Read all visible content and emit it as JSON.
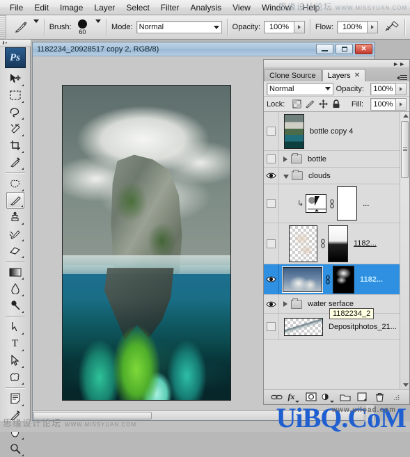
{
  "app": {
    "name": "Adobe Photoshop",
    "logo_text": "Ps"
  },
  "menubar": {
    "items": [
      {
        "label": "File"
      },
      {
        "label": "Edit"
      },
      {
        "label": "Image"
      },
      {
        "label": "Layer"
      },
      {
        "label": "Select"
      },
      {
        "label": "Filter"
      },
      {
        "label": "Analysis"
      },
      {
        "label": "View"
      },
      {
        "label": "Window"
      },
      {
        "label": "Help"
      }
    ]
  },
  "options_bar": {
    "tool_icon": "brush-icon",
    "brush_label": "Brush:",
    "brush_size": "60",
    "mode_label": "Mode:",
    "mode_value": "Normal",
    "opacity_label": "Opacity:",
    "opacity_value": "100%",
    "flow_label": "Flow:",
    "flow_value": "100%",
    "airbrush_icon": "airbrush-icon"
  },
  "toolbox": {
    "tools": [
      {
        "name": "move-tool"
      },
      {
        "name": "rectangular-marquee-tool"
      },
      {
        "name": "lasso-tool"
      },
      {
        "name": "magic-wand-tool"
      },
      {
        "name": "crop-tool"
      },
      {
        "name": "eyedropper-tool"
      },
      {
        "name": "patch-healing-tool"
      },
      {
        "name": "brush-tool"
      },
      {
        "name": "clone-stamp-tool"
      },
      {
        "name": "history-brush-tool"
      },
      {
        "name": "eraser-tool"
      },
      {
        "name": "gradient-tool"
      },
      {
        "name": "blur-tool"
      },
      {
        "name": "dodge-tool"
      },
      {
        "name": "pen-tool"
      },
      {
        "name": "type-tool"
      },
      {
        "name": "path-selection-tool"
      },
      {
        "name": "custom-shape-tool"
      },
      {
        "name": "notes-tool"
      },
      {
        "name": "eyedropper-sample-tool"
      },
      {
        "name": "hand-tool"
      },
      {
        "name": "zoom-tool"
      }
    ],
    "active_tool": "brush-tool"
  },
  "document_window": {
    "title": "1182234_20928517 copy 2, RGB/8)",
    "buttons": {
      "minimize": "minimize-button",
      "maximize": "maximize-button",
      "close": "✕"
    }
  },
  "layers_panel": {
    "tabs": [
      {
        "label": "Clone Source",
        "active": false,
        "closable": false
      },
      {
        "label": "Layers",
        "active": true,
        "closable": true,
        "close_glyph": "✕"
      }
    ],
    "blend_mode": "Normal",
    "opacity_label": "Opacity:",
    "opacity_value": "100%",
    "lock_label": "Lock:",
    "lock_icons": [
      "lock-transparent-pixels-icon",
      "lock-image-pixels-icon",
      "lock-position-icon",
      "lock-all-icon"
    ],
    "fill_label": "Fill:",
    "fill_value": "100%",
    "rows": [
      {
        "name": "bottle copy 4",
        "visible": false,
        "type": "layer",
        "thumb": "island-thumb"
      },
      {
        "name": "bottle",
        "visible": false,
        "type": "group",
        "expanded": false
      },
      {
        "name": "clouds",
        "visible": true,
        "type": "group",
        "expanded": true
      },
      {
        "name": "...",
        "visible": false,
        "type": "adjustment",
        "thumb": "gradient-map-thumb",
        "mask": "white-mask"
      },
      {
        "name": "1182...",
        "visible": false,
        "type": "layer",
        "thumb": "clouds-transparent-thumb",
        "mask": "gradient-mask"
      },
      {
        "name": "1182...",
        "visible": true,
        "type": "layer",
        "selected": true,
        "thumb": "clouds-photo-thumb",
        "mask": "black-mask"
      },
      {
        "name": "water serface",
        "visible": true,
        "type": "group",
        "expanded": false
      },
      {
        "name": "Depositphotos_21...",
        "visible": false,
        "type": "layer",
        "thumb": "water-surface-thumb"
      }
    ],
    "bottom_buttons": [
      {
        "name": "link-layers-button",
        "glyph": "link-icon"
      },
      {
        "name": "layer-style-button",
        "glyph": "fx-icon"
      },
      {
        "name": "add-layer-mask-button",
        "glyph": "mask-icon"
      },
      {
        "name": "new-adjustment-layer-button",
        "glyph": "half-circle-icon"
      },
      {
        "name": "new-group-button",
        "glyph": "folder-icon"
      },
      {
        "name": "new-layer-button",
        "glyph": "new-layer-icon"
      },
      {
        "name": "delete-layer-button",
        "glyph": "trash-icon"
      }
    ]
  },
  "tooltip": {
    "text": "1182234_2"
  },
  "watermarks": {
    "top_cn": "思缘设计论坛",
    "top_en": "WWW.MISSYUAN.COM",
    "bottom_cn": "思缘设计论坛",
    "bottom_en": "WWW.MISSYUAN.COM",
    "corner_brand": "UiBQ.CoM",
    "corner_sub": "www.uiload.com"
  },
  "colors": {
    "selection_blue": "#2f8fe0",
    "title_blue": "#a9c4dc",
    "tooltip_yellow": "#ffffe1",
    "brand_blue": "#1f5fd0",
    "close_red": "#c0392b"
  }
}
